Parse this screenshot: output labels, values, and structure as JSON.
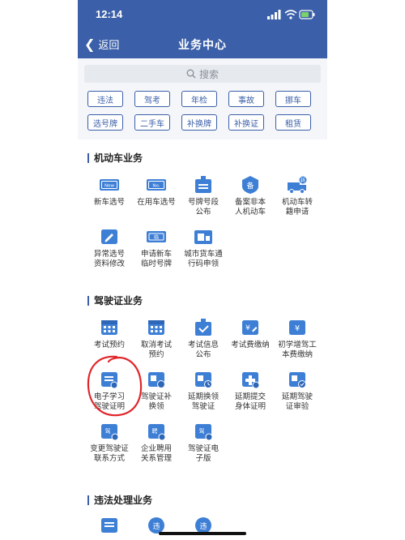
{
  "status": {
    "time": "12:14"
  },
  "nav": {
    "back": "返回",
    "title": "业务中心"
  },
  "search": {
    "placeholder": "搜索"
  },
  "chips": [
    "违法",
    "驾考",
    "年检",
    "事故",
    "挪车",
    "选号牌",
    "二手车",
    "补换牌",
    "补换证",
    "租赁"
  ],
  "sections": [
    {
      "title": "机动车业务",
      "items": [
        {
          "label": "新车选号",
          "icon": "new-plate-icon"
        },
        {
          "label": "在用车选号",
          "icon": "used-plate-icon"
        },
        {
          "label": "号牌号段\n公布",
          "icon": "plate-notice-icon"
        },
        {
          "label": "备案非本\n人机动车",
          "icon": "record-icon"
        },
        {
          "label": "机动车转\n籍申请",
          "icon": "transfer-truck-icon"
        },
        {
          "label": "异常选号\n资料修改",
          "icon": "edit-doc-icon"
        },
        {
          "label": "申请新车\n临时号牌",
          "icon": "temp-plate-icon"
        },
        {
          "label": "城市货车通\n行码申领",
          "icon": "truck-pass-icon"
        }
      ]
    },
    {
      "title": "驾驶证业务",
      "items": [
        {
          "label": "考试预约",
          "icon": "calendar-icon"
        },
        {
          "label": "取消考试\n预约",
          "icon": "calendar-cancel-icon"
        },
        {
          "label": "考试信息\n公布",
          "icon": "exam-notice-icon"
        },
        {
          "label": "考试费缴纳",
          "icon": "fee-icon"
        },
        {
          "label": "初学增驾工\n本费缴纳",
          "icon": "fee-book-icon"
        },
        {
          "label": "电子学习\n驾驶证明",
          "icon": "e-certificate-icon"
        },
        {
          "label": "驾驶证补\n换领",
          "icon": "license-renew-icon"
        },
        {
          "label": "延期换领\n驾驶证",
          "icon": "license-delay-icon"
        },
        {
          "label": "延期提交\n身体证明",
          "icon": "health-delay-icon"
        },
        {
          "label": "延期驾驶\n证审验",
          "icon": "license-audit-icon"
        },
        {
          "label": "变更驾驶证\n联系方式",
          "icon": "contact-change-icon"
        },
        {
          "label": "企业聘用\n关系管理",
          "icon": "employ-icon"
        },
        {
          "label": "驾驶证电\n子版",
          "icon": "e-license-icon"
        }
      ]
    },
    {
      "title": "违法处理业务",
      "items": [
        {
          "label": "",
          "icon": "violation-bill-icon"
        },
        {
          "label": "",
          "icon": "violation-handle-icon"
        },
        {
          "label": "",
          "icon": "violation-pay-icon"
        }
      ]
    }
  ],
  "colors": {
    "primary": "#3b5fa8",
    "icon_blue": "#3e7fd6",
    "annotation_red": "#e0262a"
  }
}
